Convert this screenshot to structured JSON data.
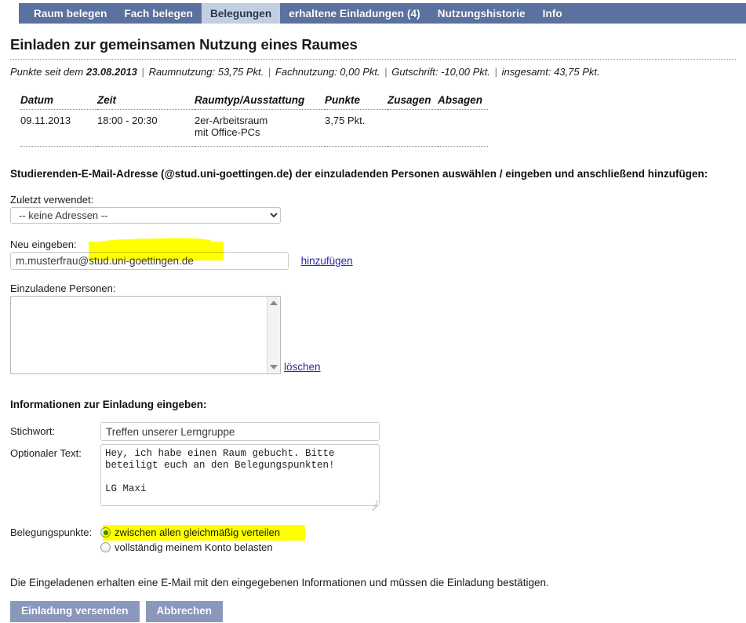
{
  "nav": {
    "items": [
      {
        "label": "Raum belegen",
        "active": false
      },
      {
        "label": "Fach belegen",
        "active": false
      },
      {
        "label": "Belegungen",
        "active": true
      },
      {
        "label": "erhaltene Einladungen (4)",
        "active": false
      },
      {
        "label": "Nutzungshistorie",
        "active": false
      },
      {
        "label": "Info",
        "active": false
      }
    ],
    "background_color": "#5b719f",
    "active_background_color": "#c3cee0"
  },
  "page": {
    "title": "Einladen zur gemeinsamen Nutzung eines Raumes",
    "points_summary": {
      "prefix": "Punkte seit dem",
      "since_date": "23.08.2013",
      "entries": [
        "Raumnutzung: 53,75 Pkt.",
        "Fachnutzung: 0,00 Pkt.",
        "Gutschrift: -10,00 Pkt.",
        "insgesamt: 43,75 Pkt."
      ],
      "separator": "|"
    }
  },
  "booking_table": {
    "headers": [
      "Datum",
      "Zeit",
      "Raumtyp/Ausstattung",
      "Punkte",
      "Zusagen",
      "Absagen"
    ],
    "rows": [
      {
        "datum": "09.11.2013",
        "zeit": "18:00 - 20:30",
        "raumtyp_line1": "2er-Arbeitsraum",
        "raumtyp_line2": "mit Office-PCs",
        "punkte": "3,75 Pkt.",
        "zusagen": "",
        "absagen": ""
      }
    ]
  },
  "invite_section": {
    "heading": "Studierenden-E-Mail-Adresse (@stud.uni-goettingen.de) der einzuladenden Personen auswählen / eingeben und anschließend hinzufügen:",
    "recent_label": "Zuletzt verwendet:",
    "recent_select_value": "-- keine Adressen --",
    "recent_select_options": [
      "-- keine Adressen --"
    ],
    "new_label": "Neu eingeben:",
    "new_email_value": "m.musterfrau@stud.uni-goettingen.de",
    "add_link": "hinzufügen",
    "invited_label": "Einzuladene Personen:",
    "invited_items": [],
    "delete_link": "löschen"
  },
  "info_section": {
    "heading": "Informationen zur Einladung eingeben:",
    "stichwort_label": "Stichwort:",
    "stichwort_value": "Treffen unserer Lerngruppe",
    "optional_label": "Optionaler Text:",
    "optional_value": "Hey, ich habe einen Raum gebucht. Bitte\nbeteiligt euch an den Belegungspunkten!\n\nLG Maxi"
  },
  "points_section": {
    "label": "Belegungspunkte:",
    "options": [
      {
        "label": "zwischen allen gleichmäßig verteilen",
        "selected": true
      },
      {
        "label": "vollständig meinem Konto belasten",
        "selected": false
      }
    ],
    "selected_marker_color": "#2d8b2d"
  },
  "footer": {
    "note": "Die Eingeladenen erhalten eine E-Mail mit den eingegebenen Informationen und müssen die Einladung bestätigen.",
    "submit_label": "Einladung versenden",
    "cancel_label": "Abbrechen",
    "button_color": "#8b98bd"
  },
  "annotations": {
    "highlight_color": "#ffff00",
    "highlights": [
      {
        "name": "email-domain-highlight",
        "covers": "stud.uni-goettingen.de"
      },
      {
        "name": "points-option-highlight",
        "covers": "zwischen allen gleichmäßig verteilen"
      }
    ]
  }
}
